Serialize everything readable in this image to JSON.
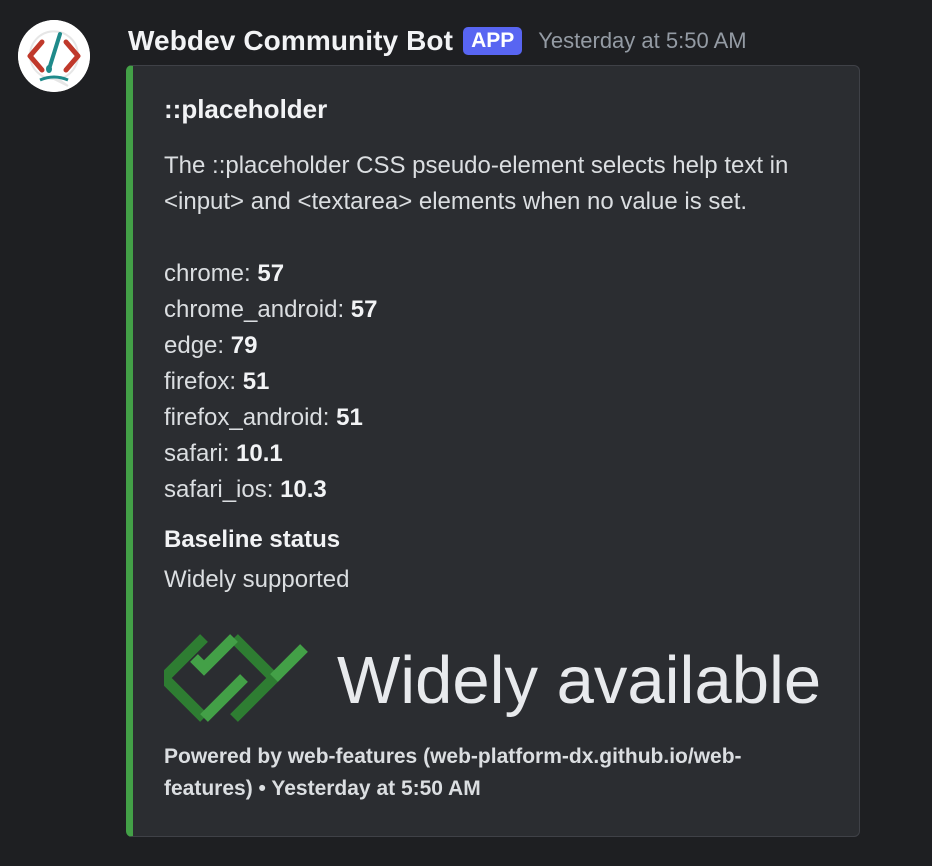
{
  "message": {
    "author": "Webdev Community Bot",
    "badge": "APP",
    "timestamp": "Yesterday at 5:50 AM",
    "avatar_icon": "webdev-logo-icon"
  },
  "embed": {
    "accent_color": "#43a047",
    "title": "::placeholder",
    "description": "The ::placeholder CSS pseudo-element selects help text in <input> and <textarea> elements when no value is set.",
    "compat": [
      {
        "browser": "chrome",
        "version": "57"
      },
      {
        "browser": "chrome_android",
        "version": "57"
      },
      {
        "browser": "edge",
        "version": "79"
      },
      {
        "browser": "firefox",
        "version": "51"
      },
      {
        "browser": "firefox_android",
        "version": "51"
      },
      {
        "browser": "safari",
        "version": "10.1"
      },
      {
        "browser": "safari_ios",
        "version": "10.3"
      }
    ],
    "field_name": "Baseline status",
    "field_value": "Widely supported",
    "image_text": "Widely available",
    "footer_text": "Powered by web-features (web-platform-dx.github.io/web-features)",
    "footer_separator": "•",
    "footer_timestamp": "Yesterday at 5:50 AM"
  }
}
